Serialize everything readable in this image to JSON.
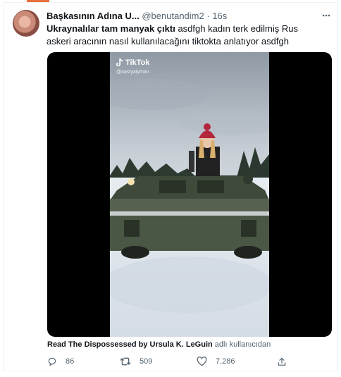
{
  "tweet": {
    "author_name": "Başkasının Adına U...",
    "author_handle": "@benutandim2",
    "separator": "·",
    "time": "16s",
    "text_bold": "Ukraynalılar tam manyak çıktı",
    "text_rest": " asdfgh kadın terk edilmiş Rus askeri aracının nasıl kullanılacağını tiktokta anlatıyor asdfgh"
  },
  "media": {
    "tiktok_logo_text": "TikTok",
    "tiktok_handle": "@nastyatyman"
  },
  "attribution": {
    "who": "Read The Dispossessed by Ursula K. LeGuin",
    "suffix": " adlı kullanıcıdan"
  },
  "actions": {
    "reply_count": "86",
    "retweet_count": "509",
    "like_count": "7.286"
  },
  "icons": {
    "more": "more-icon",
    "reply": "reply-icon",
    "retweet": "retweet-icon",
    "like": "heart-icon",
    "share": "share-icon",
    "tiktok": "tiktok-icon"
  },
  "colors": {
    "accent": "#e8703a",
    "secondary_text": "#536471",
    "primary_text": "#0f1419"
  }
}
